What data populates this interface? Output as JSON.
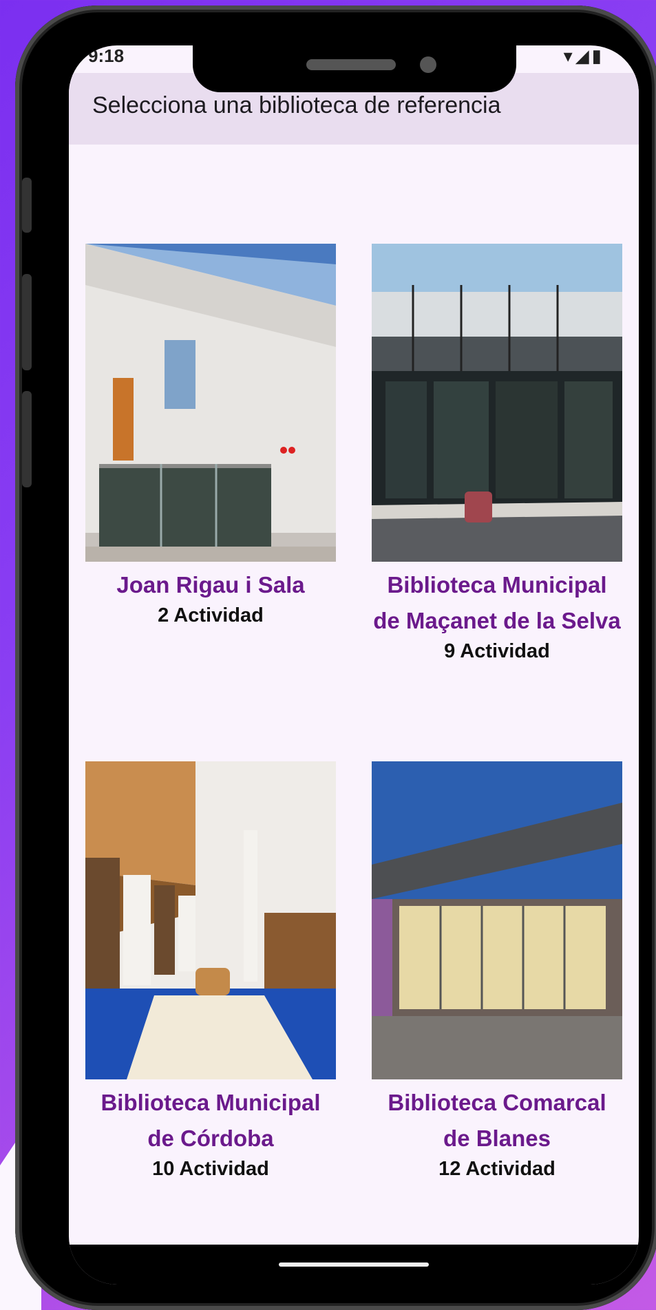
{
  "status_bar": {
    "time": "9:18",
    "icons": "▾◢▮"
  },
  "app_bar": {
    "title": "Selecciona una biblioteca de referencia"
  },
  "libraries": [
    {
      "name": "Joan Rigau i Sala",
      "count": "2 Actividad",
      "photo": "modern-white-building-icon"
    },
    {
      "name": "Biblioteca Municipal de Maçanet de la Selva",
      "count": "9 Actividad",
      "photo": "glass-facade-building-icon"
    },
    {
      "name": "Biblioteca Municipal de Córdoba",
      "count": "10 Actividad",
      "photo": "library-interior-bookshelves-icon"
    },
    {
      "name": "Biblioteca Comarcal de Blanes",
      "count": "12 Actividad",
      "photo": "library-exterior-dusk-icon"
    }
  ],
  "colors": {
    "accent": "#6b1a8c",
    "app_bar_bg": "#e9ddef",
    "screen_bg": "#faf3fd"
  }
}
